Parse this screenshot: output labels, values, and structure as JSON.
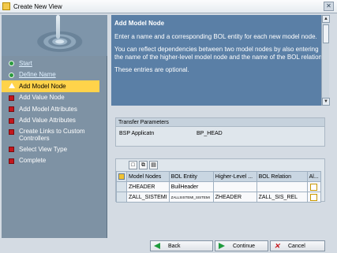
{
  "window": {
    "title": "Create New View"
  },
  "steps": [
    {
      "label": "Start",
      "state": "done"
    },
    {
      "label": "Define Name",
      "state": "done"
    },
    {
      "label": "Add Model Node",
      "state": "current"
    },
    {
      "label": "Add Value Node",
      "state": "todo"
    },
    {
      "label": "Add Model Attributes",
      "state": "todo"
    },
    {
      "label": "Add Value Attributes",
      "state": "todo"
    },
    {
      "label": "Create Links to Custom Controllers",
      "state": "todo"
    },
    {
      "label": "Select View Type",
      "state": "todo"
    },
    {
      "label": "Complete",
      "state": "todo"
    }
  ],
  "help": {
    "heading": "Add Model Node",
    "p1": "Enter a name and a corresponding BOL entity for each new model node.",
    "p2": "You can reflect dependencies between two model nodes by also entering the name of the higher-level model node and the name of the BOL relation.",
    "p3": "These entries are optional."
  },
  "transfer": {
    "title": "Transfer Parameters",
    "label": "BSP Applicatn",
    "value": "BP_HEAD"
  },
  "table": {
    "headers": [
      "Model Nodes",
      "BOL Entity",
      "Higher-Level ...",
      "BOL Relation",
      "Al..."
    ],
    "rows": [
      [
        "ZHEADER",
        "BuilHeader",
        "",
        "",
        ""
      ],
      [
        "ZALL_SISTEMI",
        "ZALLSISTEMI_SISTEMI",
        "ZHEADER",
        "ZALL_SIS_REL",
        ""
      ]
    ]
  },
  "buttons": {
    "back": "Back",
    "continue": "Continue",
    "cancel": "Cancel"
  },
  "colors": {
    "accent": "#ffd34a",
    "panel": "#5a7fa6",
    "done": "#2b9a3f",
    "todo": "#c4161c"
  }
}
